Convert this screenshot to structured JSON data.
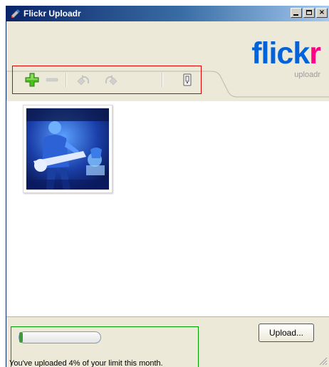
{
  "window": {
    "title": "Flickr Uploadr",
    "controls": {
      "minimize": "minimize",
      "maximize": "maximize",
      "close": "×"
    }
  },
  "logo": {
    "brand_blue": "flick",
    "brand_pink": "r",
    "subtitle": "uploadr",
    "colors": {
      "blue": "#0063dc",
      "pink": "#ff0084"
    }
  },
  "toolbar": {
    "items": [
      {
        "icon": "add-icon",
        "enabled": true
      },
      {
        "icon": "remove-icon",
        "enabled": false
      },
      {
        "icon": "rotate-left-icon",
        "enabled": false
      },
      {
        "icon": "rotate-right-icon",
        "enabled": false
      },
      {
        "icon": "properties-icon",
        "enabled": true
      }
    ]
  },
  "photos": [
    {
      "description": "guitarist on stage with blue lighting"
    }
  ],
  "status": {
    "upload_percent": 4,
    "message": "You've uploaded 4% of your limit this month."
  },
  "actions": {
    "upload_label": "Upload..."
  }
}
